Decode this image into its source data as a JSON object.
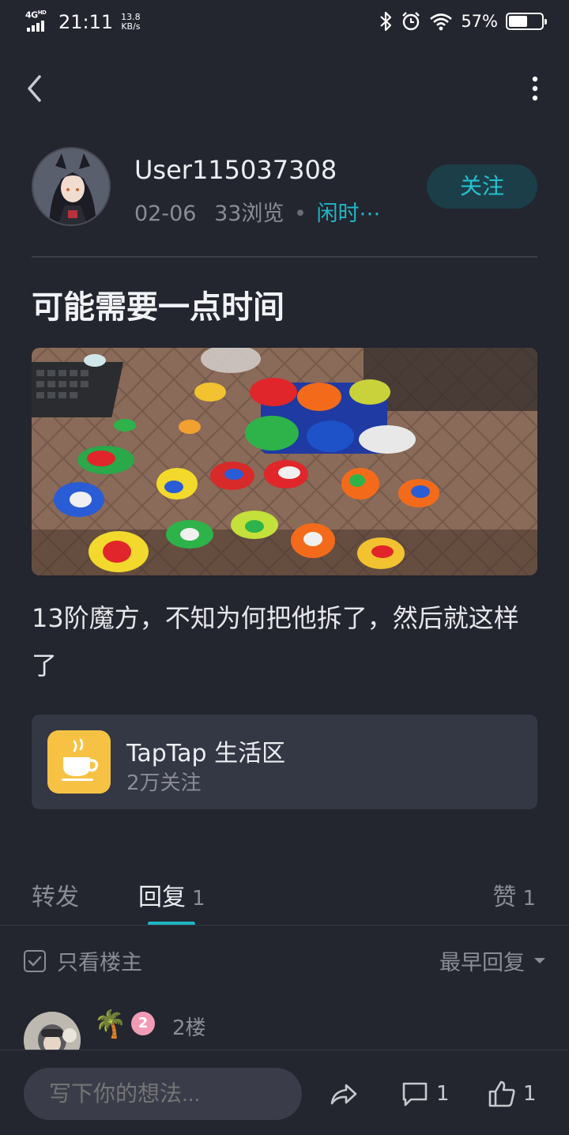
{
  "status_bar": {
    "network": "4G",
    "network_sup": "HD",
    "time": "21:11",
    "speed_value": "13.8",
    "speed_unit": "KB/s",
    "battery": "57%",
    "battery_level": 0.57
  },
  "author": {
    "name": "User115037308",
    "date": "02-06",
    "views": "33浏览",
    "tag": "闲时⋯",
    "follow_label": "关注"
  },
  "post": {
    "title": "可能需要一点时间",
    "body": "13阶魔方，不知为何把他拆了，然后就这样了"
  },
  "group": {
    "name": "TapTap 生活区",
    "followers": "2万关注"
  },
  "tabs": {
    "forward_label": "转发",
    "reply_label": "回复",
    "reply_count": "1",
    "like_label": "赞",
    "like_count": "1"
  },
  "filter": {
    "only_op_label": "只看楼主",
    "sort_label": "最早回复"
  },
  "reply": {
    "emoji": "🌴",
    "level": "2",
    "floor": "2楼"
  },
  "bottom_bar": {
    "input_placeholder": "写下你的想法...",
    "comment_count": "1",
    "like_count": "1"
  },
  "colors": {
    "background": "#23252f",
    "accent": "#1fb6c6",
    "card": "#343744",
    "group_icon": "#f7c244"
  }
}
